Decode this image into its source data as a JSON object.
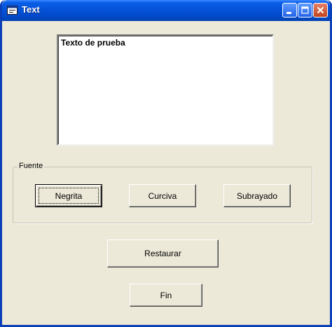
{
  "window": {
    "title": "Text"
  },
  "textbox": {
    "value": "Texto de prueba"
  },
  "group": {
    "label": "Fuente",
    "buttons": {
      "bold": "Negrita",
      "italic": "Curciva",
      "underline": "Subrayado"
    }
  },
  "actions": {
    "restore": "Restaurar",
    "exit": "Fin"
  },
  "colors": {
    "titlebar": "#0553d8",
    "face": "#ece9d8",
    "close": "#c2421a"
  }
}
